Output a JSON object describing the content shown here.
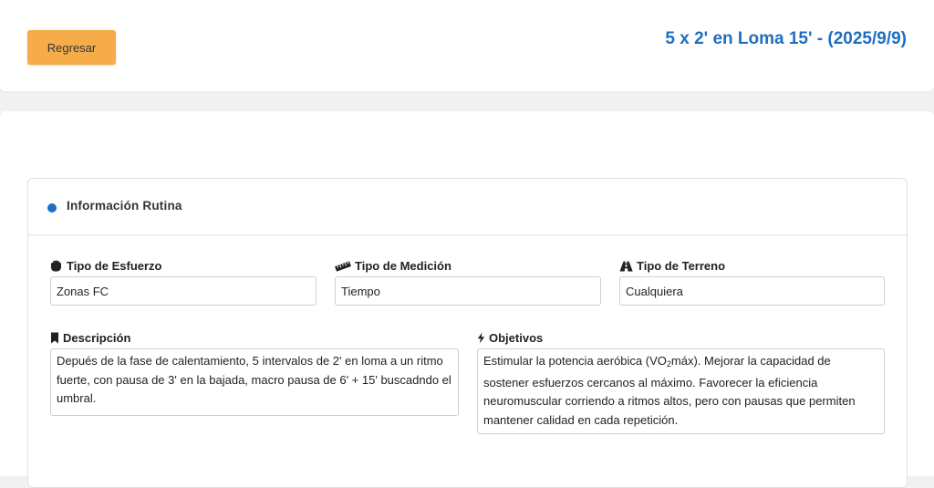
{
  "header": {
    "back_label": "Regresar",
    "title": "5 x 2' en Loma 15' - (2025/9/9)"
  },
  "panel": {
    "title": "Información Rutina"
  },
  "fields": {
    "effort": {
      "label": "Tipo de Esfuerzo",
      "value": "Zonas FC",
      "icon": "hand-icon"
    },
    "measurement": {
      "label": "Tipo de Medición",
      "value": "Tiempo",
      "icon": "ruler-icon"
    },
    "terrain": {
      "label": "Tipo de Terreno",
      "value": "Cualquiera",
      "icon": "road-icon"
    },
    "description": {
      "label": "Descripción",
      "icon": "bookmark-icon",
      "value": "Depués de la fase de calentamiento, 5 intervalos de 2' en loma a un ritmo fuerte, con pausa de 3' en la bajada, macro pausa de 6' + 15' buscadndo el umbral."
    },
    "objectives": {
      "label": "Objetivos",
      "icon": "bolt-icon",
      "value_pre": "Estimular la potencia aeróbica (VO",
      "value_sub": "2",
      "value_post": "máx). Mejorar la capacidad de sostener esfuerzos cercanos al máximo. Favorecer la eficiencia neuromuscular corriendo a ritmos altos, pero con pausas que permiten mantener calidad en cada repetición."
    }
  },
  "colors": {
    "accent": "#1d6fc1",
    "button": "#f7ac4a"
  }
}
